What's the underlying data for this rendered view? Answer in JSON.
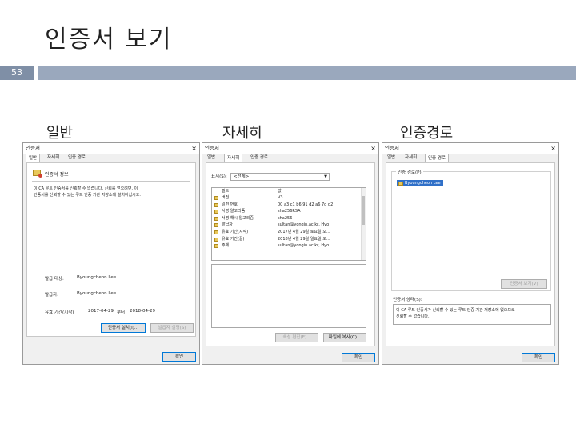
{
  "slide": {
    "title": "인증서 보기",
    "page_number": "53",
    "bar_color": "#9aa8bd",
    "num_color": "#7f8fa6"
  },
  "panels": {
    "general": {
      "label": "일반",
      "window_title": "인증서",
      "close": "×",
      "tabs": [
        "일반",
        "자세히",
        "인증 경로"
      ],
      "heading": "인증서 정보",
      "message_line1": "이 CA 루트 인증서를 신뢰할 수 없습니다. 신뢰를 얻으려면, 이",
      "message_line2": "인증서를 신뢰할 수 있는 루트 인증 기관 저장소에 설치하십시오.",
      "issued_to_label": "발급 대상:",
      "issued_to_value": "Byoungcheon Lee",
      "issued_by_label": "발급자:",
      "issued_by_value": "Byoungcheon Lee",
      "validity_label": "유효 기간(시작)",
      "validity_from": "2017-04-29",
      "validity_to_label": "부터",
      "validity_to": "2018-04-29",
      "install_button": "인증서 설치(I)...",
      "issuer_statement_button": "발급자 설명(S)",
      "ok_button": "확인"
    },
    "details": {
      "label": "자세히",
      "window_title": "인증서",
      "close": "×",
      "tabs": [
        "일반",
        "자세히",
        "인증 경로"
      ],
      "show_label": "표시(S):",
      "show_value": "<전체>",
      "col_field": "필드",
      "col_value": "값",
      "rows": [
        {
          "field": "버전",
          "value": "V3"
        },
        {
          "field": "일련 번호",
          "value": "00 a3 c1 b6 91 d2 a6 7d d2"
        },
        {
          "field": "서명 알고리즘",
          "value": "sha256RSA"
        },
        {
          "field": "서명 해시 알고리즘",
          "value": "sha256"
        },
        {
          "field": "발급자",
          "value": "sultan@yongin.ac.kr, Hyo"
        },
        {
          "field": "유효 기간(시작)",
          "value": "2017년 4월 29일 토요일 오..."
        },
        {
          "field": "유효 기간(끝)",
          "value": "2018년 4월 29일 일요일 오..."
        },
        {
          "field": "주체",
          "value": "sultan@yongin.ac.kr, Hyo"
        }
      ],
      "edit_button": "속성 편집(E)...",
      "copy_button": "파일에 복사(C)...",
      "ok_button": "확인"
    },
    "path": {
      "label": "인증경로",
      "window_title": "인증서",
      "close": "×",
      "tabs": [
        "일반",
        "자세히",
        "인증 경로"
      ],
      "path_label": "인증 경로(P)",
      "path_item": "Byoungcheon Lee",
      "view_button": "인증서 보기(V)",
      "status_label": "인증서 상태(S):",
      "status_line1": "이 CA 루트 인증서가 신뢰할 수 있는 루트 인증 기관 저장소에 없으므로",
      "status_line2": "신뢰할 수 없습니다.",
      "ok_button": "확인"
    }
  }
}
